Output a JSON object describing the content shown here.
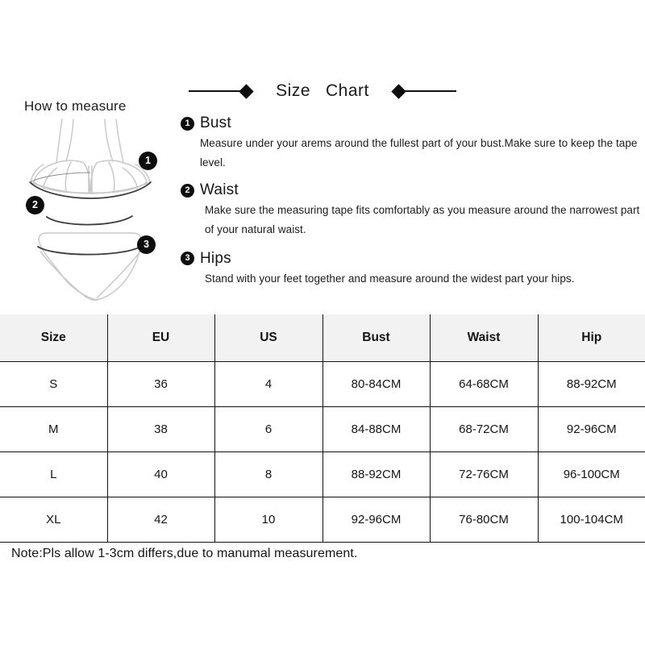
{
  "header": {
    "title": "Size   Chart",
    "left_diamond_icon": "diamond-icon",
    "right_diamond_icon": "diamond-icon"
  },
  "howto": {
    "label": "How to measure",
    "markers": [
      {
        "number": "1",
        "refers_to": "Bust"
      },
      {
        "number": "2",
        "refers_to": "Waist"
      },
      {
        "number": "3",
        "refers_to": "Hips"
      }
    ]
  },
  "instructions": [
    {
      "number": "1",
      "title": "Bust",
      "body": "Measure under your arems around the fullest part of your bust.Make sure to keep the tape level."
    },
    {
      "number": "2",
      "title": "Waist",
      "body": "Make sure the measuring tape fits comfortably as you measure around the narrowest part of your natural waist."
    },
    {
      "number": "3",
      "title": "Hips",
      "body": "Stand with your feet together and measure around the widest part your hips."
    }
  ],
  "table": {
    "columns": [
      "Size",
      "EU",
      "US",
      "Bust",
      "Waist",
      "Hip"
    ],
    "rows": [
      {
        "size": "S",
        "eu": "36",
        "us": "4",
        "bust": "80-84CM",
        "waist": "64-68CM",
        "hip": "88-92CM"
      },
      {
        "size": "M",
        "eu": "38",
        "us": "6",
        "bust": "84-88CM",
        "waist": "68-72CM",
        "hip": "92-96CM"
      },
      {
        "size": "L",
        "eu": "40",
        "us": "8",
        "bust": "88-92CM",
        "waist": "72-76CM",
        "hip": "96-100CM"
      },
      {
        "size": "XL",
        "eu": "42",
        "us": "10",
        "bust": "92-96CM",
        "waist": "76-80CM",
        "hip": "100-104CM"
      }
    ]
  },
  "note": "Note:Pls allow 1-3cm differs,due to manumal measurement.",
  "colors": {
    "text": "#141414",
    "header_background": "#f2f2f2",
    "border": "#111111",
    "marker_background": "#0d0d0d",
    "marker_text": "#ffffff",
    "illustration_outline": "#c9c9c9",
    "measure_line": "#3b3b3b"
  }
}
